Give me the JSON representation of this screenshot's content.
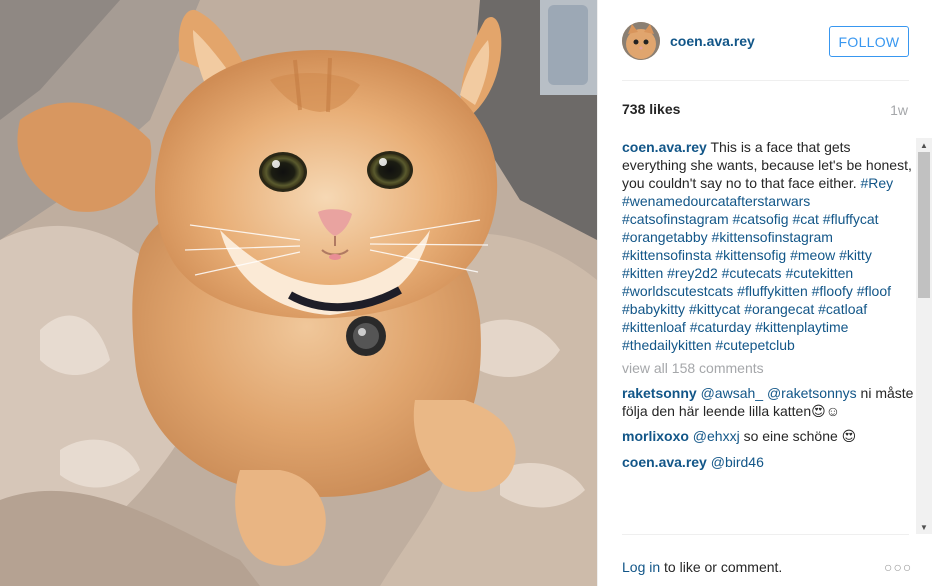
{
  "post": {
    "photo_alt": "Fluffy orange kitten with a collar sitting on a blanket",
    "header": {
      "username": "coen.ava.rey",
      "follow_label": "FOLLOW"
    },
    "likes": "738 likes",
    "time": "1w",
    "caption": {
      "username": "coen.ava.rey",
      "text": " This is a face that gets everything she wants, because let's be honest, you couldn't say no to that face either.",
      "hashtags": [
        "#Rey",
        "#wenamedourcatafterstarwars",
        "#catsofinstagram",
        "#catsofig",
        "#cat",
        "#fluffycat",
        "#orangetabby",
        "#kittensofinstagram",
        "#kittensofinsta",
        "#kittensofig",
        "#meow",
        "#kitty",
        "#kitten",
        "#rey2d2",
        "#cutecats",
        "#cutekitten",
        "#worldscutestcats",
        "#fluffykitten",
        "#floofy",
        "#floof",
        "#babykitty",
        "#kittycat",
        "#orangecat",
        "#catloaf",
        "#kittenloaf",
        "#caturday",
        "#kittenplaytime",
        "#thedailykitten",
        "#cutepetclub"
      ]
    },
    "view_all": "view all 158 comments",
    "comments": [
      {
        "user": "raketsonny",
        "mentions": [
          "@awsah_",
          "@raketsonnys"
        ],
        "text": " ni måste följa den här leende lilla katten😍☺"
      },
      {
        "user": "morlixoxo",
        "mentions": [
          "@ehxxj"
        ],
        "text": " so eine schöne 😍"
      },
      {
        "user": "coen.ava.rey",
        "mentions": [
          "@bird46"
        ],
        "text": ""
      }
    ],
    "footer": {
      "login_link": "Log in",
      "login_rest": " to like or comment.",
      "more": "○○○"
    }
  },
  "colors": {
    "link": "#125688",
    "follow": "#3897f0",
    "muted": "#a5a7aa"
  },
  "icons": {
    "scroll_up": "arrow-up-icon",
    "scroll_down": "arrow-down-icon",
    "more": "more-options-icon"
  }
}
